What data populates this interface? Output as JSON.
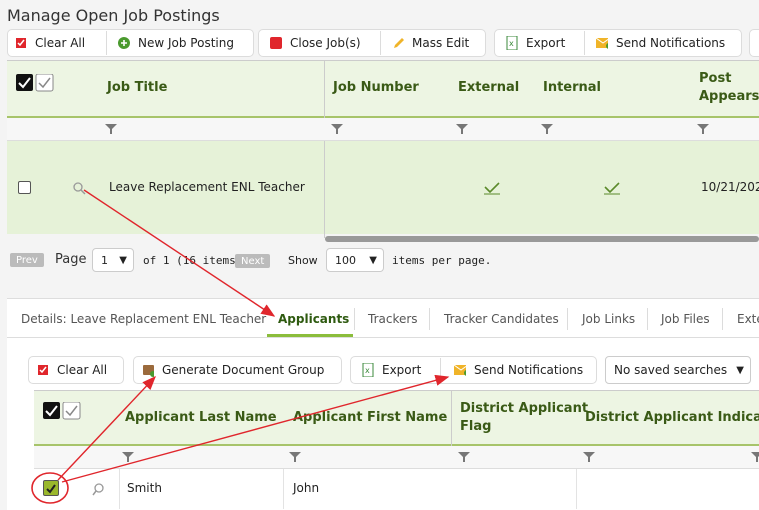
{
  "page": {
    "title": "Manage Open Job Postings"
  },
  "toolbar": {
    "clear_all": "Clear All",
    "new_job": "New Job Posting",
    "close_jobs": "Close Job(s)",
    "mass_edit": "Mass Edit",
    "export": "Export",
    "send_notifications": "Send Notifications"
  },
  "jobs_grid": {
    "columns": {
      "job_title": "Job Title",
      "job_number": "Job Number",
      "external": "External",
      "internal": "Internal",
      "post_appears_1": "Post",
      "post_appears_2": "Appears"
    },
    "row": {
      "title": "Leave Replacement ENL Teacher",
      "post_date": "10/21/202"
    },
    "pager": {
      "prev": "Prev",
      "page_label": "Page",
      "page_value": "1",
      "of_items": "of 1 (16 items)",
      "next": "Next",
      "show_label": "Show",
      "show_value": "100",
      "per_page": "items per page."
    }
  },
  "tabs": {
    "details": "Details: Leave Replacement ENL Teacher",
    "applicants": "Applicants",
    "trackers": "Trackers",
    "tracker_candidates": "Tracker Candidates",
    "job_links": "Job Links",
    "job_files": "Job Files",
    "ext": "Exte"
  },
  "applicants_toolbar": {
    "clear_all": "Clear All",
    "generate_doc_group": "Generate Document Group",
    "export": "Export",
    "send_notifications": "Send Notifications",
    "saved_searches": "No saved searches"
  },
  "applicants_grid": {
    "columns": {
      "last_name": "Applicant Last Name",
      "first_name": "Applicant First Name",
      "district_flag_1": "District Applicant",
      "district_flag_2": "Flag",
      "district_indicator": "District Applicant Indicator"
    },
    "row": {
      "last_name": "Smith",
      "first_name": "John"
    }
  },
  "colors": {
    "header_green": "#edf5e3",
    "row_green": "#e6f2d8",
    "accent_green": "#3a5a16",
    "arrow_red": "#e0262c"
  }
}
